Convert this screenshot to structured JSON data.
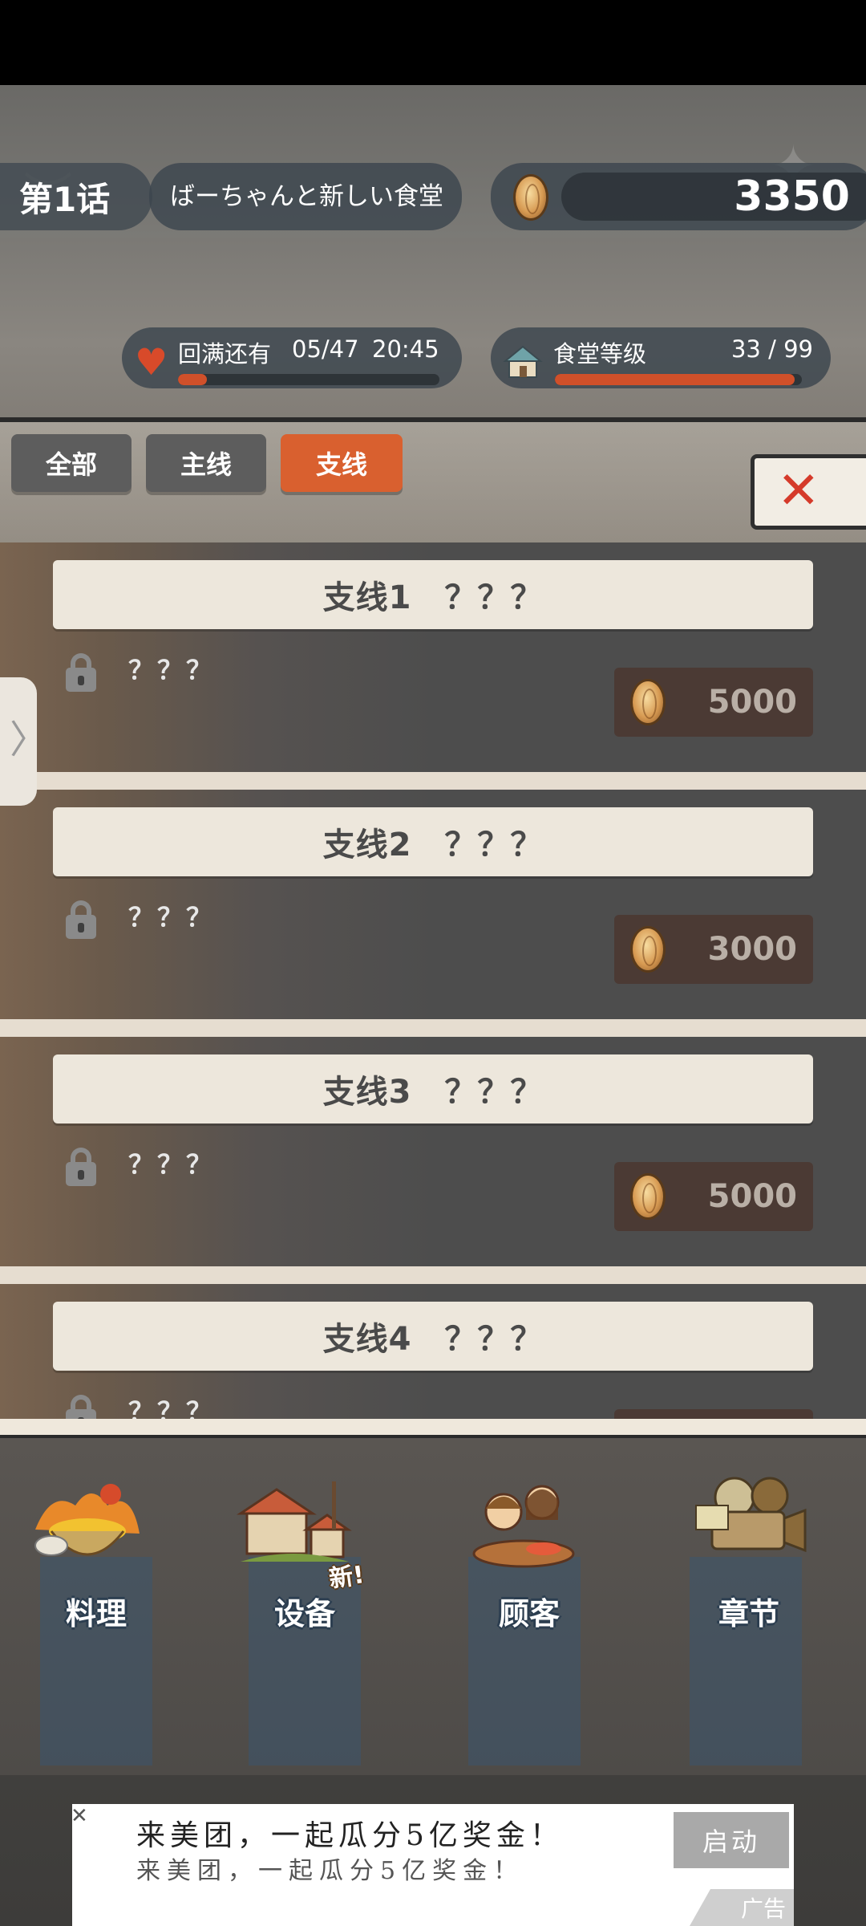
{
  "hud": {
    "chapter_number": "第1话",
    "chapter_title": "ばーちゃんと新しい食堂",
    "coins": "3350",
    "stamina_label": "回满还有",
    "stamina_count": "05/47",
    "stamina_timer": "20:45",
    "stamina_fill_fraction": 0.11,
    "level_label": "食堂等级",
    "level_value": "33 / 99",
    "level_fill_fraction": 0.97,
    "accent_color": "#d9602f"
  },
  "tabs": [
    {
      "label": "全部",
      "active": false
    },
    {
      "label": "主线",
      "active": false
    },
    {
      "label": "支线",
      "active": true
    }
  ],
  "close_button": {
    "icon": "close-icon"
  },
  "chapters": [
    {
      "title": "支线1　？？？",
      "desc": "？？？",
      "locked": true,
      "price": "5000"
    },
    {
      "title": "支线2　？？？",
      "desc": "？？？",
      "locked": true,
      "price": "3000"
    },
    {
      "title": "支线3　？？？",
      "desc": "？？？",
      "locked": true,
      "price": "5000"
    },
    {
      "title": "支线4　？？？",
      "desc": "？？？",
      "locked": true,
      "price": ""
    }
  ],
  "side_handle": {
    "icon": "chevron-right-icon"
  },
  "nav": [
    {
      "label": "料理",
      "icon": "cooking-pot-icon"
    },
    {
      "label": "设备",
      "icon": "house-facilities-icon",
      "badge": "新!"
    },
    {
      "label": "顾客",
      "icon": "customers-icon"
    },
    {
      "label": "章节",
      "icon": "film-camera-icon"
    }
  ],
  "ad": {
    "title": "来美团，一起瓜分5亿奖金！",
    "subtitle": "来美团，一起瓜分5亿奖金！",
    "button": "启动",
    "tag": "广告"
  }
}
